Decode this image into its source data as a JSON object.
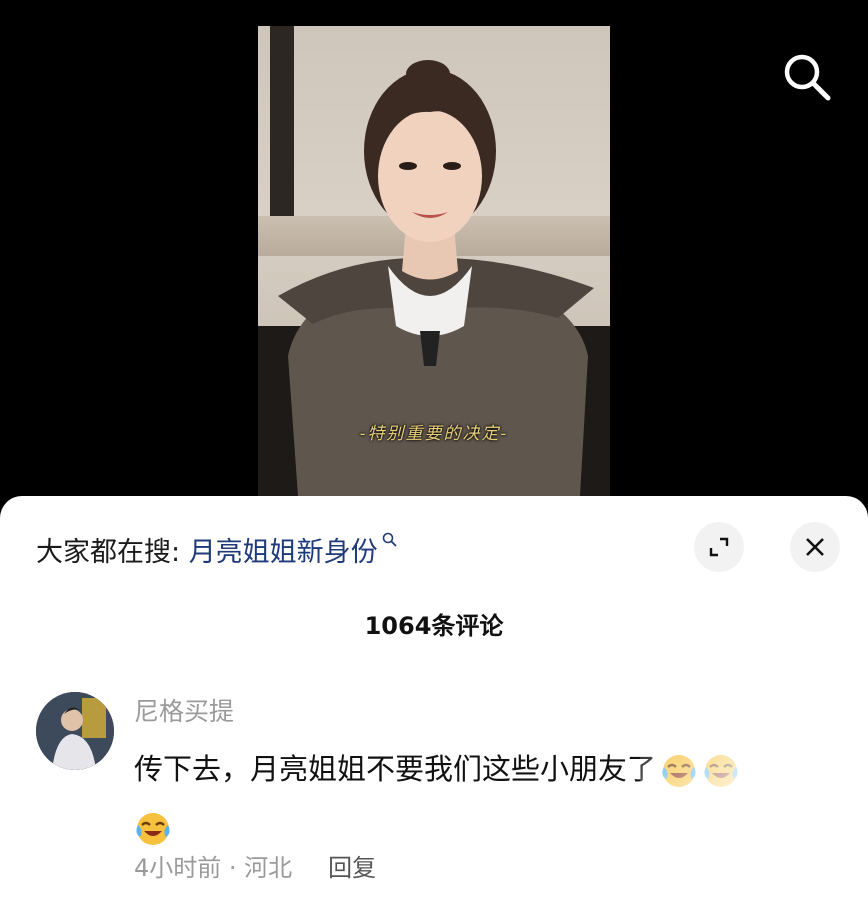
{
  "video": {
    "subtitle": "-特别重要的决定-"
  },
  "icons": {
    "top_search": "search-icon",
    "expand": "expand-icon",
    "close": "close-icon",
    "emoji": "crying-laugh-emoji"
  },
  "trending": {
    "prefix": "大家都在搜: ",
    "keyword": "月亮姐姐新身份"
  },
  "comments_header": {
    "count_label": "1064条评论"
  },
  "comment": {
    "username": "尼格买提",
    "text": "传下去，月亮姐姐不要我们这些小朋友了",
    "time": "4小时前",
    "separator": " · ",
    "location": "河北",
    "reply_label": "回复"
  },
  "colors": {
    "keyword": "#1f3a7a",
    "subtitle": "#e8cf7a",
    "meta": "#9a9a9a"
  }
}
